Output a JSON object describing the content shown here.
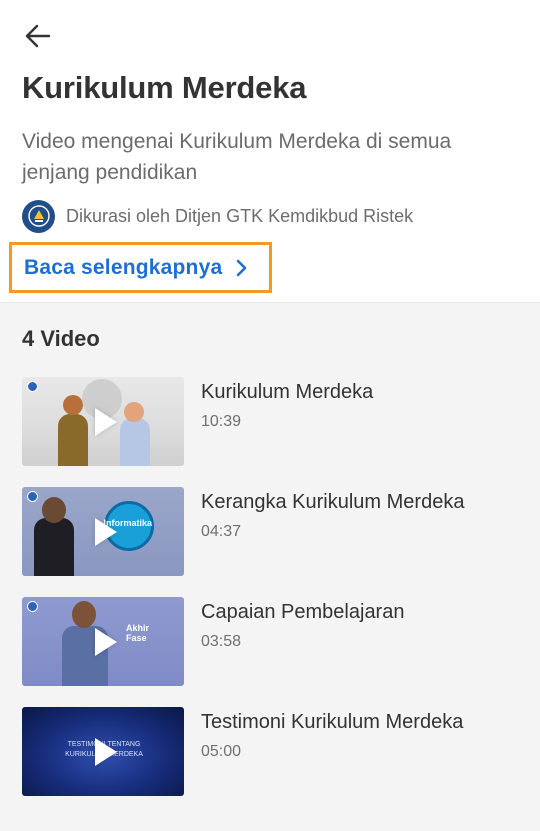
{
  "header": {
    "back_icon": "arrow-left-icon",
    "title": "Kurikulum Merdeka",
    "description": "Video mengenai Kurikulum Merdeka di semua jenjang pendidikan",
    "curator_text": "Dikurasi oleh Ditjen GTK Kemdikbud Ristek",
    "read_more_label": "Baca selengkapnya",
    "accent_color": "#1f6ed6",
    "highlight_color": "#f29b1f"
  },
  "section": {
    "title": "4 Video"
  },
  "videos": [
    {
      "title": "Kurikulum Merdeka",
      "duration": "10:39"
    },
    {
      "title": "Kerangka Kurikulum Merdeka",
      "duration": "04:37",
      "thumb_text": "Informatika"
    },
    {
      "title": "Capaian Pembelajaran",
      "duration": "03:58",
      "thumb_text": "Akhir Fase"
    },
    {
      "title": "Testimoni Kurikulum Merdeka",
      "duration": "05:00",
      "thumb_text": "TESTIMONI TENTANG KURIKULUM MERDEKA"
    }
  ]
}
